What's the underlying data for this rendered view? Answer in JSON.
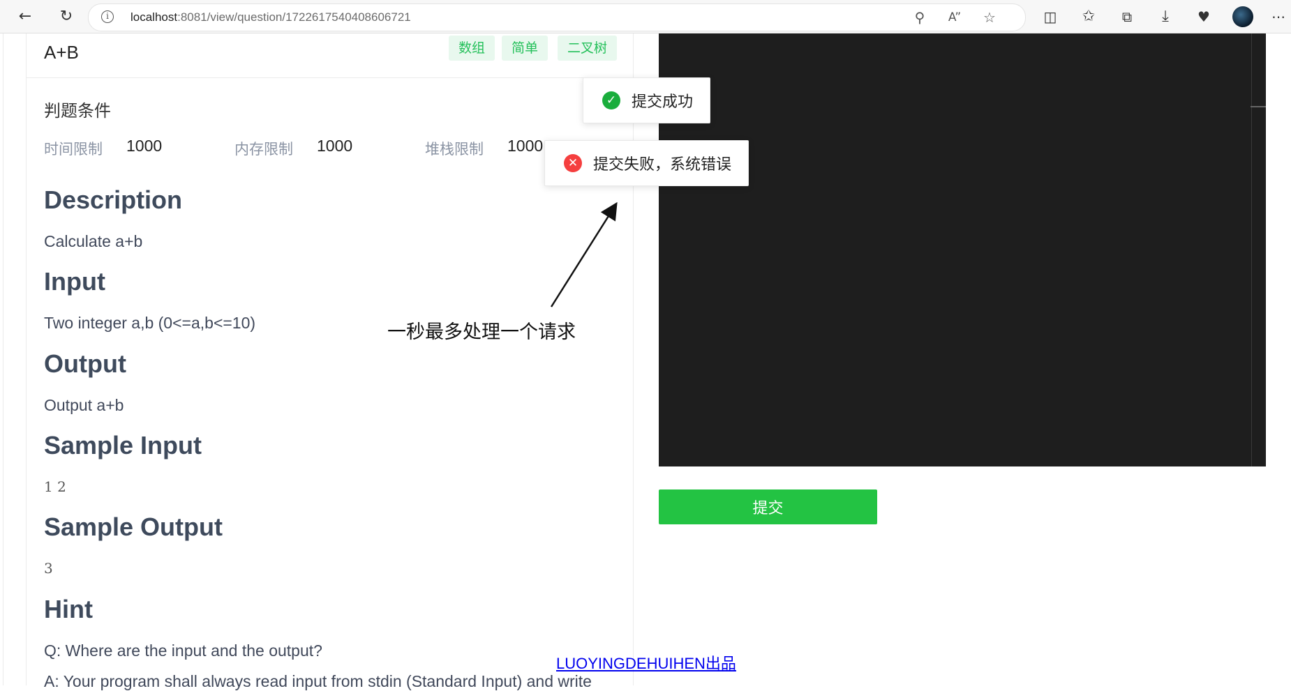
{
  "browser": {
    "url_host": "localhost",
    "url_rest": ":8081/view/question/1722617540408606721",
    "icons": [
      "back-arrow-icon",
      "refresh-icon",
      "info-icon",
      "zoom-icon",
      "read-aloud-icon",
      "favorite-star-icon",
      "split-screen-icon",
      "favorites-icon",
      "collections-icon",
      "downloads-icon",
      "performance-icon",
      "profile-avatar",
      "more-icon"
    ]
  },
  "question": {
    "title": "A+B",
    "tags": [
      "数组",
      "简单",
      "二叉树"
    ]
  },
  "conditions": {
    "heading": "判题条件",
    "time_label": "时间限制",
    "time_value": "1000",
    "memory_label": "内存限制",
    "memory_value": "1000",
    "stack_label": "堆栈限制",
    "stack_value": "1000"
  },
  "content": {
    "description_h": "Description",
    "description": "Calculate a+b",
    "input_h": "Input",
    "input": "Two integer a,b (0<=a,b<=10)",
    "output_h": "Output",
    "output": "Output a+b",
    "sample_input_h": "Sample Input",
    "sample_input": "1 2",
    "sample_output_h": "Sample Output",
    "sample_output": "3",
    "hint_h": "Hint",
    "hint_q": "Q: Where are the input and the output?",
    "hint_a": "A: Your program shall always read input from stdin (Standard Input) and write"
  },
  "editor": {
    "submit_label": "提交"
  },
  "footer": {
    "link": "LUOYINGDEHUIHEN出品"
  },
  "toasts": {
    "success": "提交成功",
    "error": "提交失败，系统错误"
  },
  "annotation": {
    "text": "一秒最多处理一个请求"
  },
  "colors": {
    "accent_green": "#23c343",
    "tag_green": "#24c05a",
    "error_red": "#f53f3f",
    "editor_bg": "#1e1e1e"
  }
}
